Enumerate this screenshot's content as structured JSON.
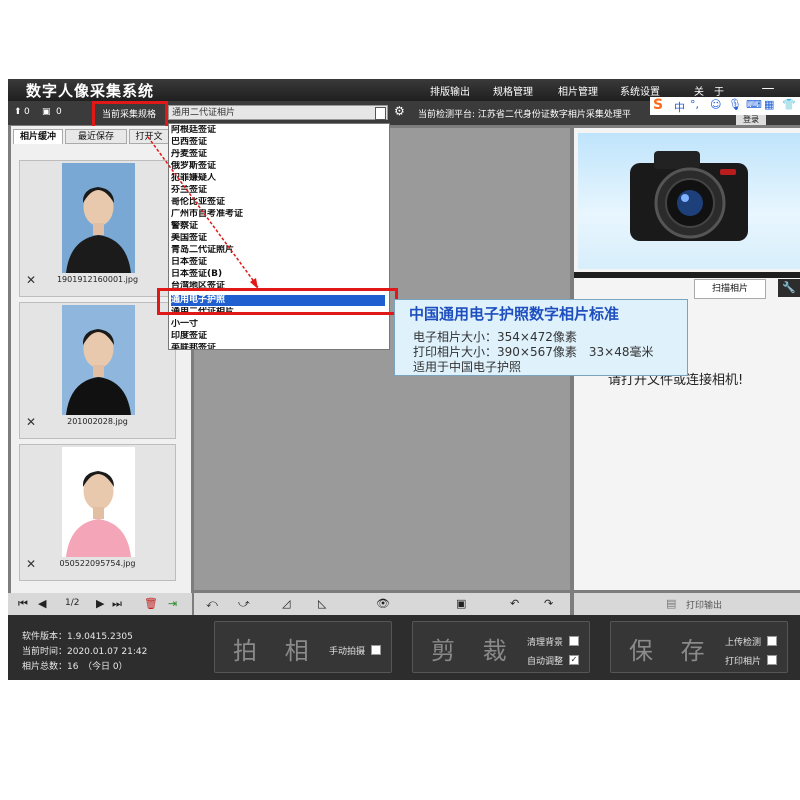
{
  "app": {
    "title": "数字人像采集系统",
    "menu": [
      "排版输出",
      "规格管理",
      "相片管理",
      "系统设置",
      "关　于"
    ],
    "window_controls": [
      "—",
      "✕"
    ]
  },
  "toolbar": {
    "upload_count": "0",
    "print_count": "0",
    "spec_label": "当前采集规格",
    "spec_value": "通用二代证相片",
    "platform_label": "当前检测平台: 江苏省二代身份证数字相片采集处理平",
    "login": "登录"
  },
  "left_tabs": [
    "相片缓冲",
    "最近保存",
    "打开文"
  ],
  "thumbnails": [
    {
      "filename": "1901912160001.jpg",
      "bg": "#7aa8d4"
    },
    {
      "filename": "201002028.jpg",
      "bg": "#8fb6dd"
    },
    {
      "filename": "050522095754.jpg",
      "bg": "#ffffff"
    }
  ],
  "dropdown": {
    "items": [
      "阿根廷签证",
      "巴西签证",
      "丹麦签证",
      "俄罗斯签证",
      "犯罪嫌疑人",
      "芬兰签证",
      "哥伦比亚签证",
      "广州市自考准考证",
      "警察证",
      "美国签证",
      "青岛二代证照片",
      "日本签证",
      "日本签证(B)",
      "台湾地区签证",
      "通用电子护照",
      "通用二代证相片",
      "小一寸",
      "印度签证",
      "英联邦签证"
    ],
    "selected_index": 14
  },
  "tooltip": {
    "title": "中国通用电子护照数字相片标准",
    "line1": "电子相片大小：354×472像素",
    "line2": "打印相片大小：390×567像素　33×48毫米",
    "line3": "适用于中国电子护照"
  },
  "right": {
    "scan_tab": "扫描相片",
    "message": "请打开文件或连接相机!",
    "print_output": "打印输出"
  },
  "pager": {
    "page": "1/2"
  },
  "bottom": {
    "software_version": "软件版本：1.9.0415.2305",
    "current_time": "当前时间：2020.01.07 21:42",
    "photo_total": "相片总数：16　（今日 0）",
    "shoot_label": "拍 相",
    "manual_shoot": "手动拍摄",
    "crop_label": "剪 裁",
    "clean_bg": "清理背景",
    "auto_adjust": "自动调整",
    "save_label": "保 存",
    "upload_check": "上传检测",
    "print_photo": "打印相片"
  },
  "ime": {
    "brand": "S",
    "mode": "中"
  },
  "colors": {
    "accent_red": "#e01818",
    "selected_blue": "#1f5fd0",
    "tooltip_title": "#1f4fbf"
  }
}
